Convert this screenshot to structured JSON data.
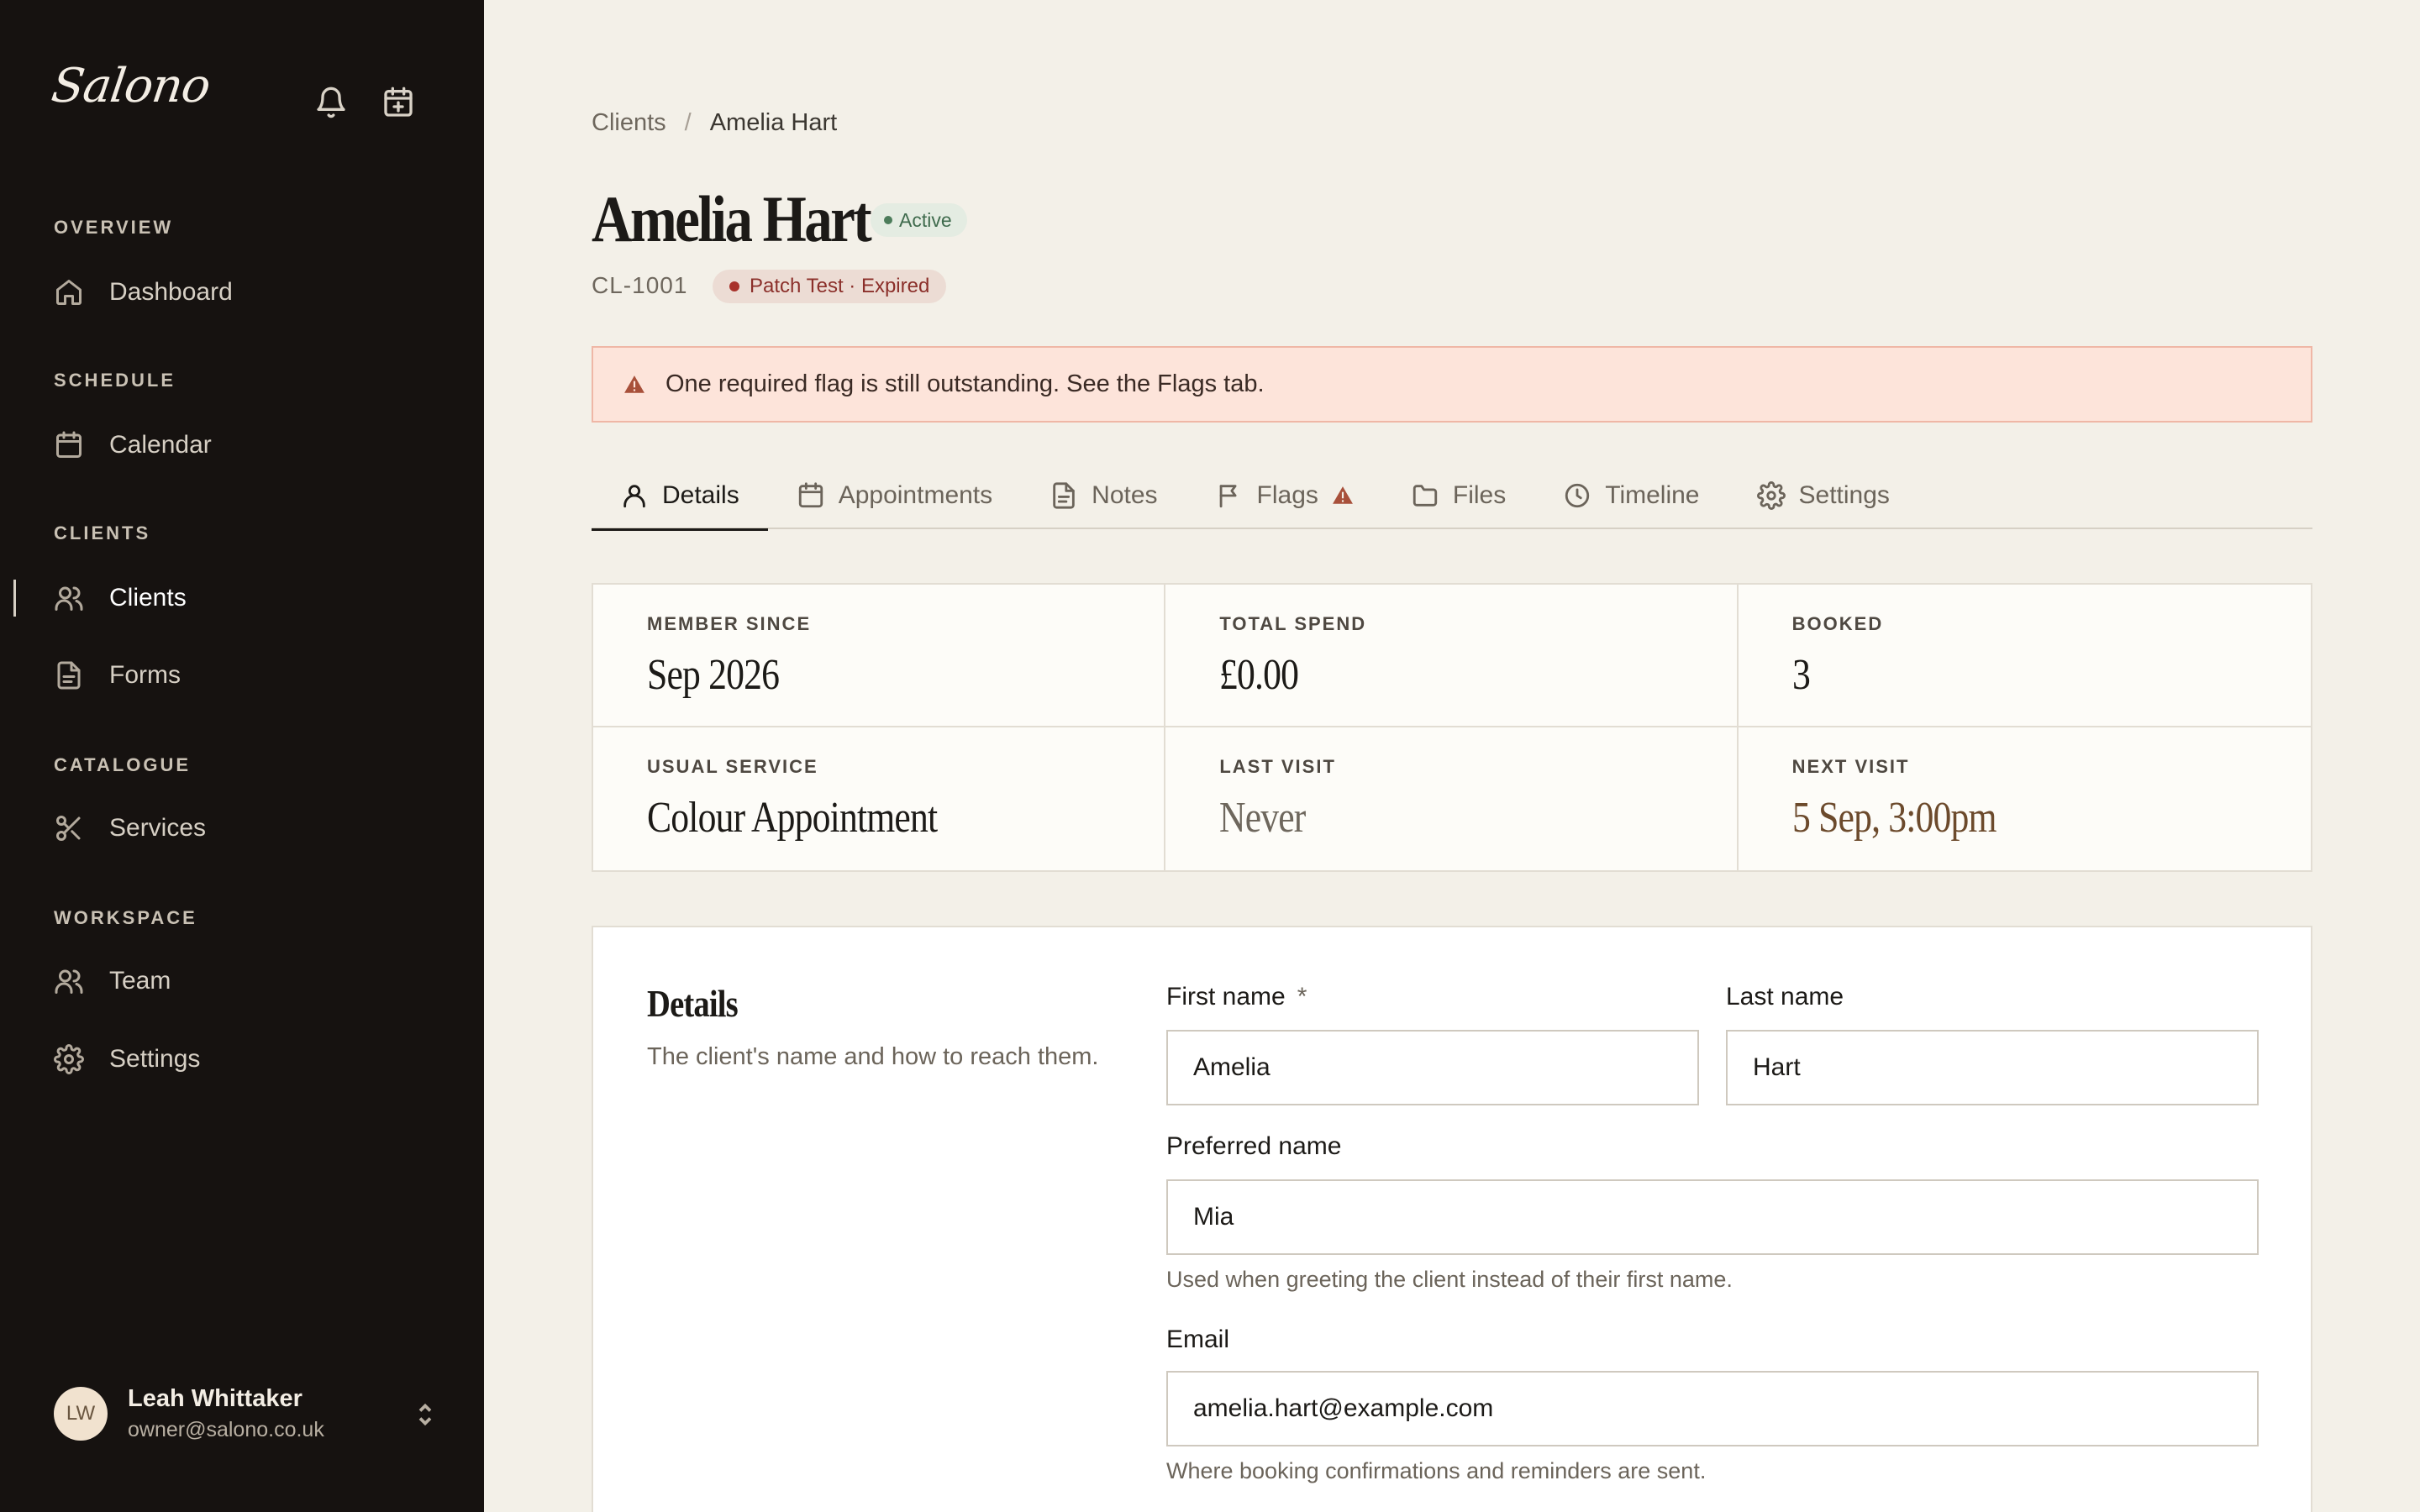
{
  "sidebar": {
    "brand": "Salono",
    "sections": [
      {
        "title": "OVERVIEW",
        "items": [
          {
            "label": "Dashboard"
          }
        ]
      },
      {
        "title": "SCHEDULE",
        "items": [
          {
            "label": "Calendar"
          }
        ]
      },
      {
        "title": "CLIENTS",
        "items": [
          {
            "label": "Clients",
            "active": true
          },
          {
            "label": "Forms"
          }
        ]
      },
      {
        "title": "CATALOGUE",
        "items": [
          {
            "label": "Services"
          }
        ]
      },
      {
        "title": "WORKSPACE",
        "items": [
          {
            "label": "Team"
          },
          {
            "label": "Settings"
          }
        ]
      }
    ],
    "user": {
      "initials": "LW",
      "name": "Leah Whittaker",
      "email": "owner@salono.co.uk"
    }
  },
  "breadcrumb": {
    "parent": "Clients",
    "separator": "/",
    "current": "Amelia Hart"
  },
  "client": {
    "name": "Amelia Hart",
    "status": "Active",
    "id": "CL-1001",
    "patch_test": "Patch Test · Expired"
  },
  "alert": {
    "message": "One required flag is still outstanding. See the Flags tab."
  },
  "tabs": [
    {
      "label": "Details",
      "icon": "user-icon",
      "active": true
    },
    {
      "label": "Appointments",
      "icon": "calendar-icon"
    },
    {
      "label": "Notes",
      "icon": "document-icon"
    },
    {
      "label": "Flags",
      "icon": "flag-icon",
      "warning": true
    },
    {
      "label": "Files",
      "icon": "folder-icon"
    },
    {
      "label": "Timeline",
      "icon": "clock-icon"
    },
    {
      "label": "Settings",
      "icon": "gear-icon"
    }
  ],
  "stats": [
    {
      "label": "MEMBER SINCE",
      "value": "Sep 2026"
    },
    {
      "label": "TOTAL SPEND",
      "value": "£0.00"
    },
    {
      "label": "BOOKED",
      "value": "3"
    },
    {
      "label": "USUAL SERVICE",
      "value": "Colour Appointment"
    },
    {
      "label": "LAST VISIT",
      "value": "Never"
    },
    {
      "label": "NEXT VISIT",
      "value": "5 Sep, 3:00pm"
    }
  ],
  "details_card": {
    "title": "Details",
    "description": "The client's name and how to reach them.",
    "fields": {
      "first_name": {
        "label": "First name",
        "required_mark": "*",
        "value": "Amelia"
      },
      "last_name": {
        "label": "Last name",
        "value": "Hart"
      },
      "preferred_name": {
        "label": "Preferred name",
        "value": "Mia",
        "hint": "Used when greeting the client instead of their first name."
      },
      "email": {
        "label": "Email",
        "value": "amelia.hart@example.com",
        "hint": "Where booking confirmations and reminders are sent."
      }
    }
  },
  "colors": {
    "sidebar_bg": "#161210",
    "page_bg": "#f3f0e8",
    "alert_bg": "#fde4da",
    "active_badge": "#e4ece2",
    "danger_badge": "#ecdcd4",
    "accent_text": "#6c4a2c"
  }
}
